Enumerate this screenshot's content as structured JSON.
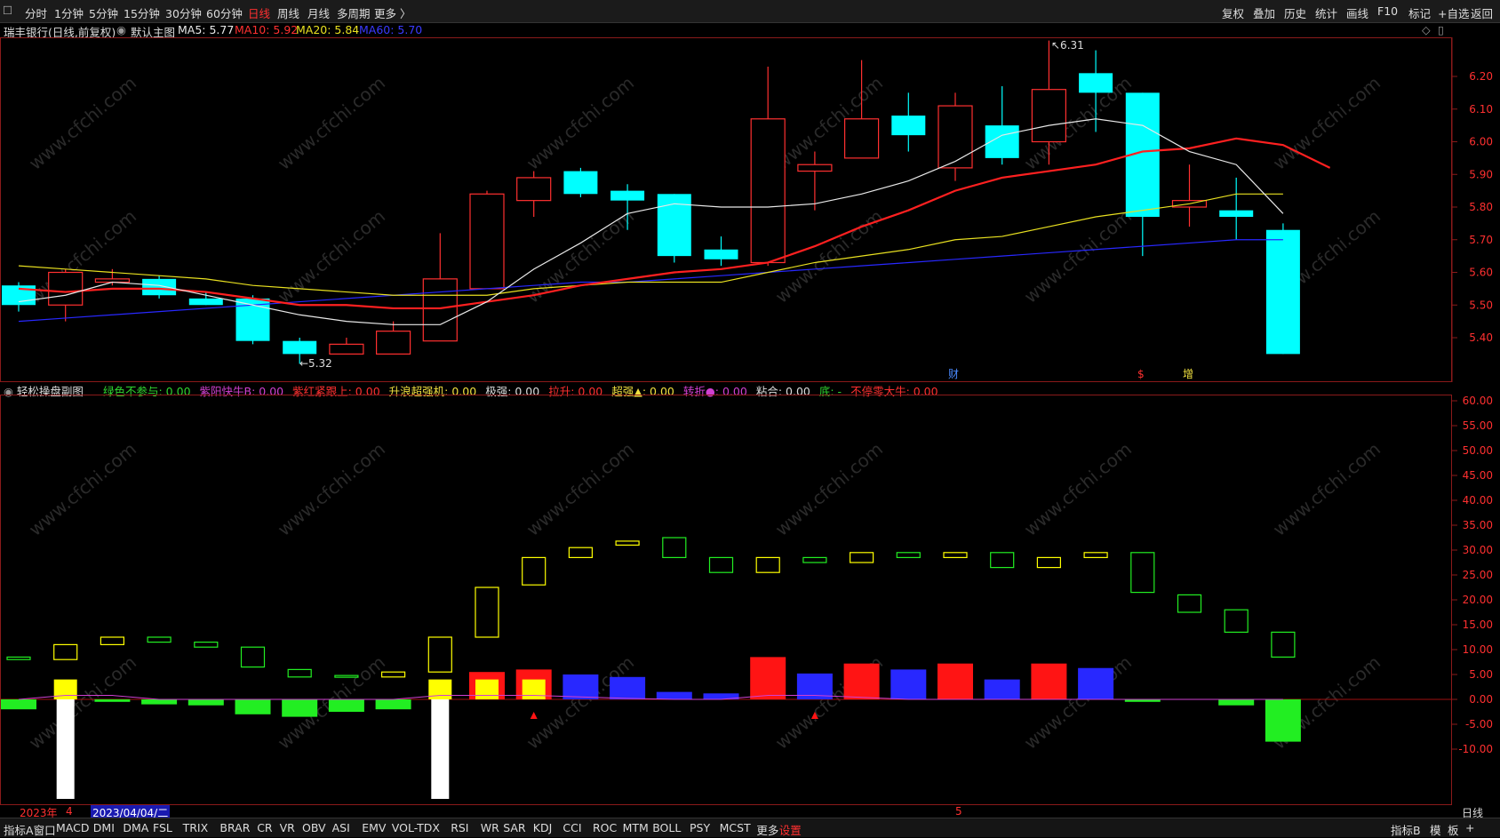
{
  "toolbar": {
    "periods": [
      "分时",
      "1分钟",
      "5分钟",
      "15分钟",
      "30分钟",
      "60分钟",
      "日线",
      "周线",
      "月线",
      "多周期",
      "更多 〉"
    ],
    "active_period": "日线",
    "right_items": [
      "复权",
      "叠加",
      "历史",
      "统计",
      "画线",
      "F10",
      "标记",
      "+自选",
      "返回"
    ]
  },
  "main_info": {
    "stock": "瑞丰银行(日线,前复权)",
    "template": "默认主图",
    "ma5": "MA5: 5.77",
    "ma10": "MA10: 5.92",
    "ma20": "MA20: 5.84",
    "ma60": "MA60: 5.70"
  },
  "sub_info": {
    "title": "轻松操盘副图",
    "items": [
      {
        "text": "绿色不参与: 0.00",
        "color": "#2fd62f"
      },
      {
        "text": "紫阳快牛B: 0.00",
        "color": "#d040d0"
      },
      {
        "text": "紫红紧跟上: 0.00",
        "color": "#ff3030"
      },
      {
        "text": "升浪超强机: 0.00",
        "color": "#f0e040"
      },
      {
        "text": "极强: 0.00",
        "color": "#dddddd"
      },
      {
        "text": "拉升: 0.00",
        "color": "#ff3030"
      },
      {
        "text": "超强▲: 0.00",
        "color": "#f0e040"
      },
      {
        "text": "转折●: 0.00",
        "color": "#d040d0"
      },
      {
        "text": "粘合: 0.00",
        "color": "#dddddd"
      },
      {
        "text": "底: -",
        "color": "#2fd62f"
      },
      {
        "text": "不停零大牛: 0.00",
        "color": "#ff3030"
      }
    ]
  },
  "annotations": {
    "high": "6.31",
    "low": "5.32",
    "marker_cai": "财",
    "marker_s": "$",
    "marker_zeng": "增"
  },
  "watermark": "www.cfchi.com",
  "date_bar": {
    "year": "2023年",
    "month": "4",
    "cursor_date": "2023/04/04/二",
    "month2": "5",
    "right_label": "日线"
  },
  "bottom_tabs": [
    "指标A",
    "窗口",
    "MACD",
    "DMI",
    "DMA",
    "FSL",
    "TRIX",
    "BRAR",
    "CR",
    "VR",
    "OBV",
    "ASI",
    "EMV",
    "VOL-TDX",
    "RSI",
    "WR",
    "SAR",
    "KDJ",
    "CCI",
    "ROC",
    "MTM",
    "BOLL",
    "PSY",
    "MCST",
    "更多",
    "设置"
  ],
  "bottom_right": [
    "指标B",
    "模",
    "板",
    "+"
  ],
  "colors": {
    "up": "#ff3030",
    "down": "#00ffff",
    "ma5": "#e8e8e8",
    "ma10": "#ff2020",
    "ma20": "#e8e020",
    "ma60": "#2828ff"
  },
  "chart_data": [
    {
      "type": "candlestick",
      "title": "瑞丰银行(日线,前复权)",
      "ylim": [
        5.32,
        6.31
      ],
      "yticks": [
        5.4,
        5.5,
        5.6,
        5.7,
        5.8,
        5.9,
        6.0,
        6.1,
        6.2
      ],
      "candles": [
        {
          "o": 5.5,
          "c": 5.56,
          "h": 5.57,
          "l": 5.48,
          "dir": "down"
        },
        {
          "o": 5.5,
          "c": 5.6,
          "h": 5.61,
          "l": 5.45,
          "dir": "up"
        },
        {
          "o": 5.57,
          "c": 5.58,
          "h": 5.61,
          "l": 5.56,
          "dir": "up"
        },
        {
          "o": 5.58,
          "c": 5.53,
          "h": 5.59,
          "l": 5.52,
          "dir": "down"
        },
        {
          "o": 5.52,
          "c": 5.5,
          "h": 5.54,
          "l": 5.5,
          "dir": "down"
        },
        {
          "o": 5.52,
          "c": 5.39,
          "h": 5.53,
          "l": 5.38,
          "dir": "down"
        },
        {
          "o": 5.39,
          "c": 5.35,
          "h": 5.4,
          "l": 5.32,
          "dir": "down"
        },
        {
          "o": 5.35,
          "c": 5.38,
          "h": 5.4,
          "l": 5.35,
          "dir": "up"
        },
        {
          "o": 5.35,
          "c": 5.42,
          "h": 5.45,
          "l": 5.35,
          "dir": "up"
        },
        {
          "o": 5.39,
          "c": 5.58,
          "h": 5.72,
          "l": 5.39,
          "dir": "up"
        },
        {
          "o": 5.55,
          "c": 5.84,
          "h": 5.85,
          "l": 5.55,
          "dir": "up"
        },
        {
          "o": 5.82,
          "c": 5.89,
          "h": 5.91,
          "l": 5.77,
          "dir": "up"
        },
        {
          "o": 5.91,
          "c": 5.84,
          "h": 5.92,
          "l": 5.83,
          "dir": "down"
        },
        {
          "o": 5.85,
          "c": 5.82,
          "h": 5.87,
          "l": 5.73,
          "dir": "down"
        },
        {
          "o": 5.84,
          "c": 5.65,
          "h": 5.84,
          "l": 5.63,
          "dir": "down"
        },
        {
          "o": 5.67,
          "c": 5.64,
          "h": 5.71,
          "l": 5.62,
          "dir": "down"
        },
        {
          "o": 5.63,
          "c": 6.07,
          "h": 6.23,
          "l": 5.62,
          "dir": "up"
        },
        {
          "o": 5.91,
          "c": 5.93,
          "h": 5.97,
          "l": 5.79,
          "dir": "up"
        },
        {
          "o": 5.95,
          "c": 6.07,
          "h": 6.25,
          "l": 5.95,
          "dir": "up"
        },
        {
          "o": 6.08,
          "c": 6.02,
          "h": 6.15,
          "l": 5.97,
          "dir": "down"
        },
        {
          "o": 5.92,
          "c": 6.11,
          "h": 6.15,
          "l": 5.88,
          "dir": "up"
        },
        {
          "o": 6.05,
          "c": 5.95,
          "h": 6.17,
          "l": 5.93,
          "dir": "down"
        },
        {
          "o": 6.0,
          "c": 6.16,
          "h": 6.31,
          "l": 5.93,
          "dir": "up"
        },
        {
          "o": 6.21,
          "c": 6.15,
          "h": 6.28,
          "l": 6.03,
          "dir": "down"
        },
        {
          "o": 6.15,
          "c": 5.77,
          "h": 6.15,
          "l": 5.65,
          "dir": "down"
        },
        {
          "o": 5.8,
          "c": 5.82,
          "h": 5.93,
          "l": 5.74,
          "dir": "up"
        },
        {
          "o": 5.79,
          "c": 5.77,
          "h": 5.89,
          "l": 5.7,
          "dir": "down"
        },
        {
          "o": 5.73,
          "c": 5.35,
          "h": 5.75,
          "l": 5.35,
          "dir": "down"
        }
      ],
      "ma5": [
        5.51,
        5.53,
        5.57,
        5.56,
        5.53,
        5.5,
        5.47,
        5.45,
        5.44,
        5.44,
        5.51,
        5.61,
        5.69,
        5.78,
        5.81,
        5.8,
        5.8,
        5.81,
        5.84,
        5.88,
        5.94,
        6.02,
        6.05,
        6.07,
        6.05,
        5.97,
        5.93,
        5.78
      ],
      "ma10": [
        5.55,
        5.54,
        5.55,
        5.55,
        5.54,
        5.52,
        5.5,
        5.5,
        5.49,
        5.49,
        5.51,
        5.53,
        5.56,
        5.58,
        5.6,
        5.61,
        5.63,
        5.68,
        5.74,
        5.79,
        5.85,
        5.89,
        5.91,
        5.93,
        5.97,
        5.98,
        6.01,
        5.99,
        5.92
      ],
      "ma20": [
        5.62,
        5.61,
        5.6,
        5.59,
        5.58,
        5.56,
        5.55,
        5.54,
        5.53,
        5.53,
        5.53,
        5.55,
        5.56,
        5.57,
        5.57,
        5.57,
        5.6,
        5.63,
        5.65,
        5.67,
        5.7,
        5.71,
        5.74,
        5.77,
        5.79,
        5.81,
        5.84,
        5.84
      ],
      "ma60": [
        5.45,
        5.46,
        5.47,
        5.48,
        5.49,
        5.5,
        5.51,
        5.52,
        5.53,
        5.54,
        5.55,
        5.56,
        5.57,
        5.57,
        5.58,
        5.59,
        5.6,
        5.61,
        5.62,
        5.63,
        5.64,
        5.65,
        5.66,
        5.67,
        5.68,
        5.69,
        5.7,
        5.7
      ]
    },
    {
      "type": "bar",
      "title": "轻松操盘副图",
      "ylim": [
        -20,
        60
      ],
      "yticks": [
        -10,
        -5,
        0,
        5,
        10,
        15,
        20,
        25,
        30,
        35,
        40,
        45,
        50,
        55,
        60
      ],
      "hollow": [
        {
          "lo": 8,
          "hi": 8.5,
          "c": "green"
        },
        {
          "lo": 8,
          "hi": 11,
          "c": "yellow"
        },
        {
          "lo": 11,
          "hi": 12.5,
          "c": "yellow"
        },
        {
          "lo": 11.5,
          "hi": 12.5,
          "c": "green"
        },
        {
          "lo": 10.5,
          "hi": 11.5,
          "c": "green"
        },
        {
          "lo": 6.5,
          "hi": 10.5,
          "c": "green"
        },
        {
          "lo": 4.5,
          "hi": 6,
          "c": "green"
        },
        {
          "lo": 4.5,
          "hi": 4.8,
          "c": "green"
        },
        {
          "lo": 4.5,
          "hi": 5.5,
          "c": "yellow"
        },
        {
          "lo": 5.5,
          "hi": 12.5,
          "c": "yellow"
        },
        {
          "lo": 12.5,
          "hi": 22.5,
          "c": "yellow"
        },
        {
          "lo": 23,
          "hi": 28.5,
          "c": "yellow"
        },
        {
          "lo": 28.5,
          "hi": 30.5,
          "c": "yellow"
        },
        {
          "lo": 31,
          "hi": 31.8,
          "c": "yellow"
        },
        {
          "lo": 28.5,
          "hi": 32.5,
          "c": "green"
        },
        {
          "lo": 25.5,
          "hi": 28.5,
          "c": "green"
        },
        {
          "lo": 25.5,
          "hi": 28.5,
          "c": "yellow"
        },
        {
          "lo": 27.5,
          "hi": 28.5,
          "c": "green"
        },
        {
          "lo": 27.5,
          "hi": 29.5,
          "c": "yellow"
        },
        {
          "lo": 28.5,
          "hi": 29.5,
          "c": "green"
        },
        {
          "lo": 28.5,
          "hi": 29.5,
          "c": "yellow"
        },
        {
          "lo": 26.5,
          "hi": 29.5,
          "c": "green"
        },
        {
          "lo": 26.5,
          "hi": 28.5,
          "c": "yellow"
        },
        {
          "lo": 28.5,
          "hi": 29.5,
          "c": "yellow"
        },
        {
          "lo": 21.5,
          "hi": 29.5,
          "c": "green"
        },
        {
          "lo": 17.5,
          "hi": 21,
          "c": "green"
        },
        {
          "lo": 13.5,
          "hi": 18,
          "c": "green"
        },
        {
          "lo": 8.5,
          "hi": 13.5,
          "c": "green"
        }
      ],
      "solid": [
        {
          "v": -2,
          "c": "green"
        },
        {
          "v": 4,
          "c": "yellow",
          "white": -20
        },
        {
          "v": -0.5,
          "c": "green"
        },
        {
          "v": -1,
          "c": "green"
        },
        {
          "v": -1.2,
          "c": "green"
        },
        {
          "v": -3,
          "c": "green"
        },
        {
          "v": -3.5,
          "c": "green"
        },
        {
          "v": -2.5,
          "c": "green"
        },
        {
          "v": -2,
          "c": "green"
        },
        {
          "v": 4,
          "c": "yellow",
          "white": -20
        },
        {
          "v": 5.5,
          "c": "red",
          "inner": 4
        },
        {
          "v": 6,
          "c": "red",
          "inner": 4
        },
        {
          "v": 5,
          "c": "blue"
        },
        {
          "v": 4.5,
          "c": "blue"
        },
        {
          "v": 1.5,
          "c": "blue"
        },
        {
          "v": 1.2,
          "c": "blue"
        },
        {
          "v": 8.5,
          "c": "red"
        },
        {
          "v": 5.2,
          "c": "blue"
        },
        {
          "v": 7.2,
          "c": "red"
        },
        {
          "v": 6,
          "c": "blue"
        },
        {
          "v": 7.2,
          "c": "red"
        },
        {
          "v": 4,
          "c": "blue"
        },
        {
          "v": 7.2,
          "c": "red"
        },
        {
          "v": 6.3,
          "c": "blue"
        },
        {
          "v": -0.5,
          "c": "green"
        },
        {
          "v": 0,
          "c": "none"
        },
        {
          "v": -1.2,
          "c": "green"
        },
        {
          "v": -8.5,
          "c": "green"
        }
      ]
    }
  ]
}
